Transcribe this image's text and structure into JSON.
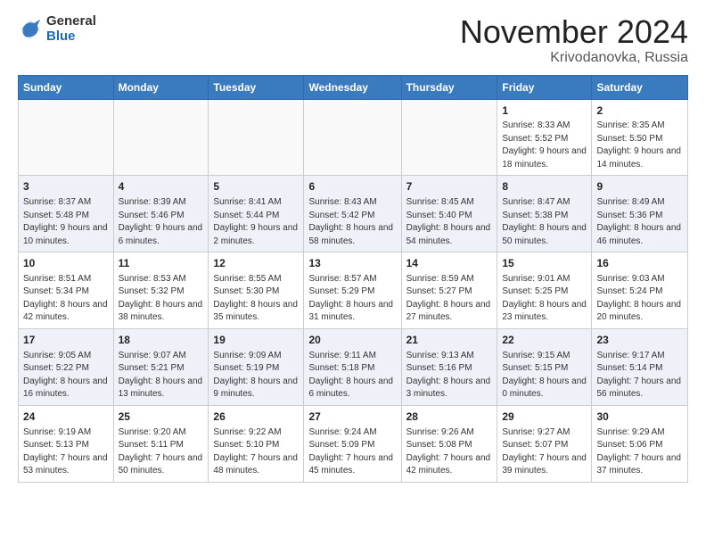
{
  "header": {
    "logo_general": "General",
    "logo_blue": "Blue",
    "month_title": "November 2024",
    "location": "Krivodanovka, Russia"
  },
  "weekdays": [
    "Sunday",
    "Monday",
    "Tuesday",
    "Wednesday",
    "Thursday",
    "Friday",
    "Saturday"
  ],
  "weeks": [
    [
      {
        "day": "",
        "info": ""
      },
      {
        "day": "",
        "info": ""
      },
      {
        "day": "",
        "info": ""
      },
      {
        "day": "",
        "info": ""
      },
      {
        "day": "",
        "info": ""
      },
      {
        "day": "1",
        "info": "Sunrise: 8:33 AM\nSunset: 5:52 PM\nDaylight: 9 hours and 18 minutes."
      },
      {
        "day": "2",
        "info": "Sunrise: 8:35 AM\nSunset: 5:50 PM\nDaylight: 9 hours and 14 minutes."
      }
    ],
    [
      {
        "day": "3",
        "info": "Sunrise: 8:37 AM\nSunset: 5:48 PM\nDaylight: 9 hours and 10 minutes."
      },
      {
        "day": "4",
        "info": "Sunrise: 8:39 AM\nSunset: 5:46 PM\nDaylight: 9 hours and 6 minutes."
      },
      {
        "day": "5",
        "info": "Sunrise: 8:41 AM\nSunset: 5:44 PM\nDaylight: 9 hours and 2 minutes."
      },
      {
        "day": "6",
        "info": "Sunrise: 8:43 AM\nSunset: 5:42 PM\nDaylight: 8 hours and 58 minutes."
      },
      {
        "day": "7",
        "info": "Sunrise: 8:45 AM\nSunset: 5:40 PM\nDaylight: 8 hours and 54 minutes."
      },
      {
        "day": "8",
        "info": "Sunrise: 8:47 AM\nSunset: 5:38 PM\nDaylight: 8 hours and 50 minutes."
      },
      {
        "day": "9",
        "info": "Sunrise: 8:49 AM\nSunset: 5:36 PM\nDaylight: 8 hours and 46 minutes."
      }
    ],
    [
      {
        "day": "10",
        "info": "Sunrise: 8:51 AM\nSunset: 5:34 PM\nDaylight: 8 hours and 42 minutes."
      },
      {
        "day": "11",
        "info": "Sunrise: 8:53 AM\nSunset: 5:32 PM\nDaylight: 8 hours and 38 minutes."
      },
      {
        "day": "12",
        "info": "Sunrise: 8:55 AM\nSunset: 5:30 PM\nDaylight: 8 hours and 35 minutes."
      },
      {
        "day": "13",
        "info": "Sunrise: 8:57 AM\nSunset: 5:29 PM\nDaylight: 8 hours and 31 minutes."
      },
      {
        "day": "14",
        "info": "Sunrise: 8:59 AM\nSunset: 5:27 PM\nDaylight: 8 hours and 27 minutes."
      },
      {
        "day": "15",
        "info": "Sunrise: 9:01 AM\nSunset: 5:25 PM\nDaylight: 8 hours and 23 minutes."
      },
      {
        "day": "16",
        "info": "Sunrise: 9:03 AM\nSunset: 5:24 PM\nDaylight: 8 hours and 20 minutes."
      }
    ],
    [
      {
        "day": "17",
        "info": "Sunrise: 9:05 AM\nSunset: 5:22 PM\nDaylight: 8 hours and 16 minutes."
      },
      {
        "day": "18",
        "info": "Sunrise: 9:07 AM\nSunset: 5:21 PM\nDaylight: 8 hours and 13 minutes."
      },
      {
        "day": "19",
        "info": "Sunrise: 9:09 AM\nSunset: 5:19 PM\nDaylight: 8 hours and 9 minutes."
      },
      {
        "day": "20",
        "info": "Sunrise: 9:11 AM\nSunset: 5:18 PM\nDaylight: 8 hours and 6 minutes."
      },
      {
        "day": "21",
        "info": "Sunrise: 9:13 AM\nSunset: 5:16 PM\nDaylight: 8 hours and 3 minutes."
      },
      {
        "day": "22",
        "info": "Sunrise: 9:15 AM\nSunset: 5:15 PM\nDaylight: 8 hours and 0 minutes."
      },
      {
        "day": "23",
        "info": "Sunrise: 9:17 AM\nSunset: 5:14 PM\nDaylight: 7 hours and 56 minutes."
      }
    ],
    [
      {
        "day": "24",
        "info": "Sunrise: 9:19 AM\nSunset: 5:13 PM\nDaylight: 7 hours and 53 minutes."
      },
      {
        "day": "25",
        "info": "Sunrise: 9:20 AM\nSunset: 5:11 PM\nDaylight: 7 hours and 50 minutes."
      },
      {
        "day": "26",
        "info": "Sunrise: 9:22 AM\nSunset: 5:10 PM\nDaylight: 7 hours and 48 minutes."
      },
      {
        "day": "27",
        "info": "Sunrise: 9:24 AM\nSunset: 5:09 PM\nDaylight: 7 hours and 45 minutes."
      },
      {
        "day": "28",
        "info": "Sunrise: 9:26 AM\nSunset: 5:08 PM\nDaylight: 7 hours and 42 minutes."
      },
      {
        "day": "29",
        "info": "Sunrise: 9:27 AM\nSunset: 5:07 PM\nDaylight: 7 hours and 39 minutes."
      },
      {
        "day": "30",
        "info": "Sunrise: 9:29 AM\nSunset: 5:06 PM\nDaylight: 7 hours and 37 minutes."
      }
    ]
  ]
}
